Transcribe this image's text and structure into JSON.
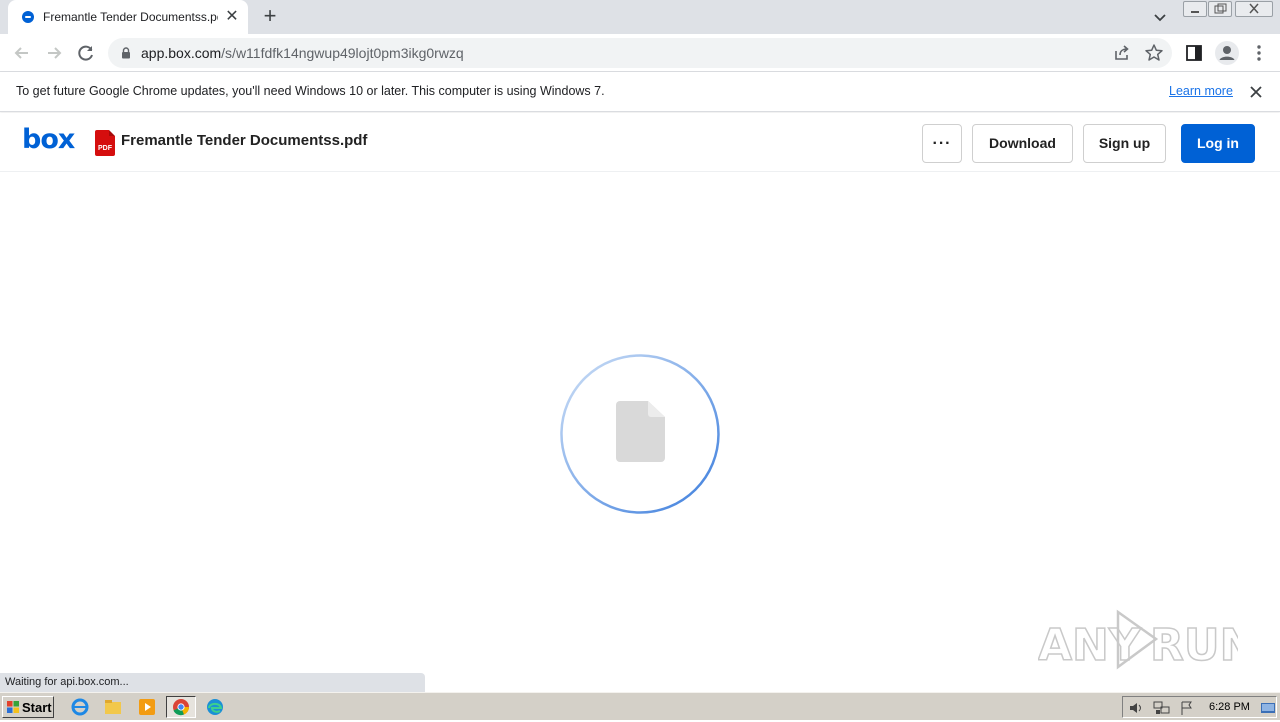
{
  "browser": {
    "tab_title": "Fremantle Tender Documentss.pdf | Powered by Box",
    "new_tab_symbol": "+",
    "close_tab_symbol": "✕"
  },
  "toolbar": {
    "url_host": "app.box.com",
    "url_path": "/s/w11fdfk14ngwup49lojt0pm3ikg0rwzq"
  },
  "infobar": {
    "message": "To get future Google Chrome updates, you'll need Windows 10 or later. This computer is using Windows 7.",
    "learn_more": "Learn more"
  },
  "box_header": {
    "logo": "box",
    "file_icon_label": "PDF",
    "file_name": "Fremantle Tender Documentss.pdf",
    "more_label": "···",
    "download_label": "Download",
    "signup_label": "Sign up",
    "login_label": "Log in"
  },
  "status_bubble": "Waiting for api.box.com...",
  "watermark_text": "ANY RUN",
  "taskbar": {
    "start_label": "Start",
    "clock": "6:28 PM"
  },
  "colors": {
    "box_blue": "#0061d5",
    "pdf_red": "#d50e0e",
    "chrome_tab_strip": "#dee1e6",
    "spinner": "#3b7ddd"
  }
}
